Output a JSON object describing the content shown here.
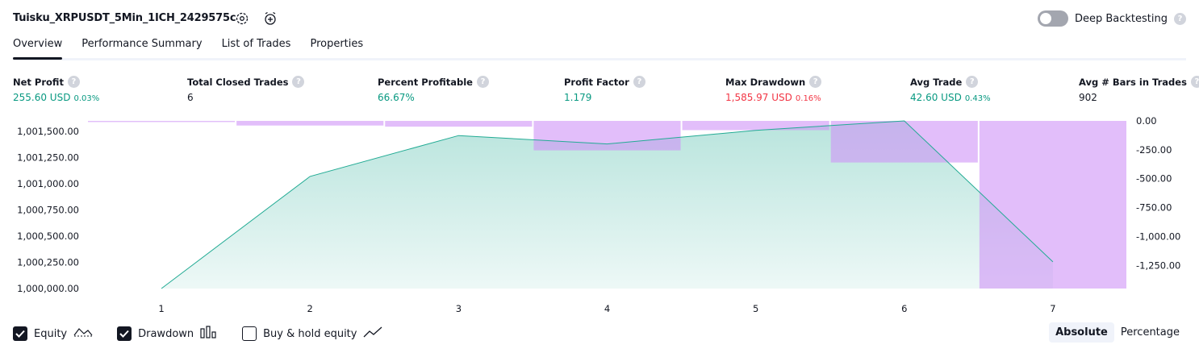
{
  "header": {
    "title": "Tuisku_XRPUSDT_5Min_1ICH_2429575c",
    "deep_backtesting_label": "Deep Backtesting",
    "deep_backtesting_enabled": false,
    "help": "?"
  },
  "tabs": [
    {
      "label": "Overview",
      "active": true
    },
    {
      "label": "Performance Summary",
      "active": false
    },
    {
      "label": "List of Trades",
      "active": false
    },
    {
      "label": "Properties",
      "active": false
    }
  ],
  "metrics": [
    {
      "label": "Net Profit",
      "value": "255.60 USD",
      "pct": "0.03%",
      "color": "green"
    },
    {
      "label": "Total Closed Trades",
      "value": "6",
      "pct": "",
      "color": "dark"
    },
    {
      "label": "Percent Profitable",
      "value": "66.67%",
      "pct": "",
      "color": "green"
    },
    {
      "label": "Profit Factor",
      "value": "1.179",
      "pct": "",
      "color": "green"
    },
    {
      "label": "Max Drawdown",
      "value": "1,585.97 USD",
      "pct": "0.16%",
      "color": "red"
    },
    {
      "label": "Avg Trade",
      "value": "42.60 USD",
      "pct": "0.43%",
      "color": "green"
    },
    {
      "label": "Avg # Bars in Trades",
      "value": "902",
      "pct": "",
      "color": "dark"
    }
  ],
  "chart_data": {
    "type": "line",
    "x": [
      1,
      2,
      3,
      4,
      5,
      6,
      7
    ],
    "x_tick_labels": [
      "1",
      "2",
      "3",
      "4",
      "5",
      "6",
      "7"
    ],
    "left_axis": {
      "ticks": [
        1000000,
        1000250,
        1000500,
        1000750,
        1001000,
        1001250,
        1001500
      ],
      "tick_labels": [
        "1,000,000.00",
        "1,000,250.00",
        "1,000,500.00",
        "1,000,750.00",
        "1,001,000.00",
        "1,001,250.00",
        "1,001,500.00"
      ],
      "range": [
        1000000,
        1001600
      ]
    },
    "right_axis": {
      "ticks": [
        0,
        -250,
        -500,
        -750,
        -1000,
        -1250
      ],
      "tick_labels": [
        "0.00",
        "-250.00",
        "-500.00",
        "-750.00",
        "-1,000.00",
        "-1,250.00"
      ],
      "range": [
        -1450,
        0
      ]
    },
    "series": [
      {
        "name": "Equity",
        "type": "area",
        "axis": "left",
        "values": [
          1000000,
          1001070,
          1001460,
          1001380,
          1001510,
          1001600,
          1000255
        ],
        "color": "#22ab94"
      },
      {
        "name": "Drawdown",
        "type": "bar",
        "axis": "right",
        "values": [
          -10,
          -40,
          -50,
          -255,
          -80,
          -360,
          -1450
        ],
        "color": "#ce93f6"
      }
    ],
    "grid": false
  },
  "legend": [
    {
      "label": "Equity",
      "checked": true,
      "icon": "equity-line-icon"
    },
    {
      "label": "Drawdown",
      "checked": true,
      "icon": "drawdown-bars-icon"
    },
    {
      "label": "Buy & hold equity",
      "checked": false,
      "icon": "buy-hold-line-icon"
    }
  ],
  "scale_buttons": [
    {
      "label": "Absolute",
      "active": true
    },
    {
      "label": "Percentage",
      "active": false
    }
  ]
}
